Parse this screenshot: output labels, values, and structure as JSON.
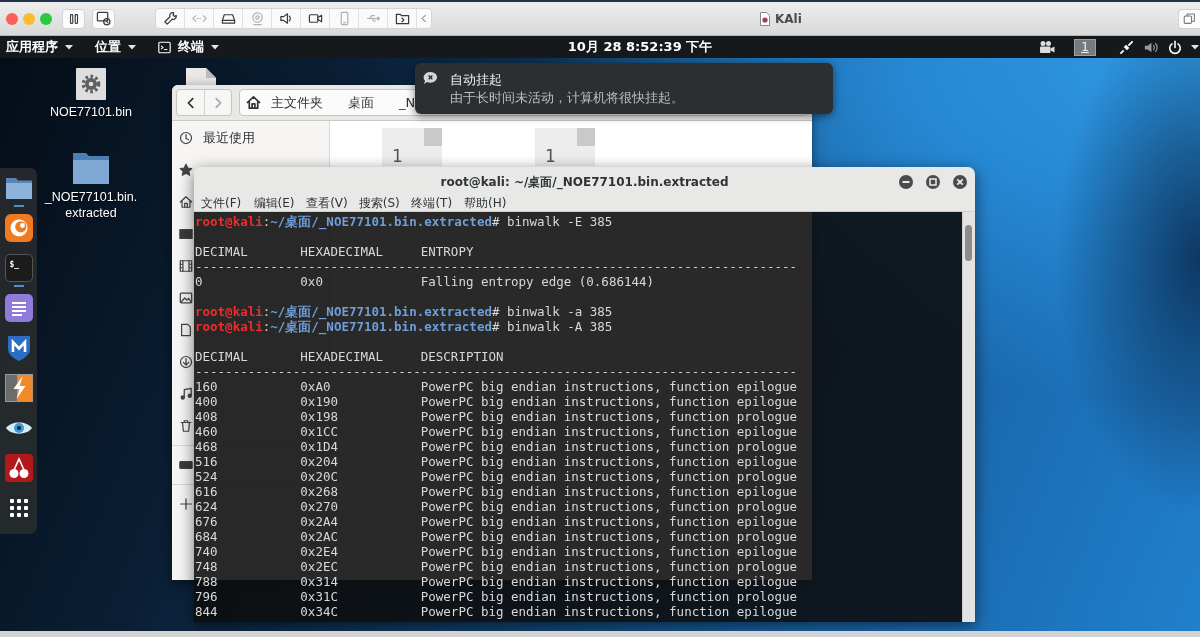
{
  "vm_window": {
    "title": "KAli",
    "toolbar": [
      {
        "kind": "wrench",
        "disabled": false
      },
      {
        "kind": "arrows",
        "disabled": true
      },
      {
        "kind": "drive",
        "disabled": false
      },
      {
        "kind": "webcam",
        "disabled": true
      },
      {
        "kind": "speaker",
        "disabled": false
      },
      {
        "kind": "camera",
        "disabled": false
      },
      {
        "kind": "phone",
        "disabled": true
      },
      {
        "kind": "usb",
        "disabled": true
      },
      {
        "kind": "folder",
        "disabled": false
      },
      {
        "kind": "chevron",
        "disabled": false
      }
    ]
  },
  "panel": {
    "menus": [
      {
        "kind": "menu",
        "label": "应用程序"
      },
      {
        "kind": "menu",
        "label": "位置"
      },
      {
        "kind": "app",
        "label": "终端"
      }
    ],
    "clock": "10月 28 8:52:39 下午",
    "workspace": "1"
  },
  "desktop": {
    "icons": [
      {
        "kind": "file",
        "label": "NOE77101.bin"
      },
      {
        "kind": "folder",
        "label": "_NOE77101.bin.extracted"
      },
      {
        "kind": "page"
      }
    ]
  },
  "dock": {
    "items": [
      {
        "kind": "files",
        "running": true
      },
      {
        "kind": "browser",
        "running": false
      },
      {
        "kind": "terminal",
        "glyph": "$_",
        "running": true
      },
      {
        "kind": "editor",
        "running": false
      },
      {
        "kind": "shield",
        "running": false
      },
      {
        "kind": "bolt",
        "running": false
      },
      {
        "kind": "eye",
        "running": false
      },
      {
        "kind": "cherries",
        "running": false
      },
      {
        "kind": "grid",
        "running": false
      }
    ]
  },
  "file_manager": {
    "nav": [
      {
        "kind": "back",
        "disabled": false
      },
      {
        "kind": "forward",
        "disabled": true
      }
    ],
    "path": [
      {
        "kind": "home",
        "label": "主文件夹"
      },
      {
        "kind": "folder",
        "label": "桌面"
      },
      {
        "kind": "folder",
        "label": "_N"
      }
    ],
    "sidebar": {
      "items": [
        {
          "kind": "recent",
          "label": "最近使用"
        },
        {
          "kind": "starred"
        },
        {
          "kind": "home"
        },
        {
          "kind": "desktop"
        },
        {
          "kind": "videos"
        },
        {
          "kind": "pictures"
        },
        {
          "kind": "documents"
        },
        {
          "kind": "downloads"
        },
        {
          "kind": "music"
        },
        {
          "kind": "trash"
        },
        {
          "kind": "separator"
        },
        {
          "kind": "drive"
        },
        {
          "kind": "separator"
        },
        {
          "kind": "other"
        }
      ]
    },
    "files": [
      {
        "preview": "1"
      },
      {
        "preview": "1"
      }
    ]
  },
  "notification": {
    "title": "自动挂起",
    "body": "由于长时间未活动，计算机将很快挂起。"
  },
  "terminal": {
    "title": "root@kali: ~/桌面/_NOE77101.bin.extracted",
    "menu": [
      "文件(F)",
      "编辑(E)",
      "查看(V)",
      "搜索(S)",
      "终端(T)",
      "帮助(H)"
    ],
    "lines": [
      {
        "kind": "prompt",
        "user": "root@kali",
        "separator": ":",
        "path": "~/桌面/_NOE77101.bin.extracted",
        "symbol": "#",
        "command": "binwalk -E 385"
      },
      {
        "kind": "blank"
      },
      {
        "kind": "header",
        "cells": [
          "DECIMAL",
          "HEXADECIMAL",
          "ENTROPY"
        ]
      },
      {
        "kind": "rule",
        "text": "--------------------------------------------------------------------------------"
      },
      {
        "kind": "row",
        "cells": [
          "0",
          "0x0",
          "Falling entropy edge (0.686144)"
        ]
      },
      {
        "kind": "blank"
      },
      {
        "kind": "prompt",
        "user": "root@kali",
        "separator": ":",
        "path": "~/桌面/_NOE77101.bin.extracted",
        "symbol": "#",
        "command": "binwalk -a 385"
      },
      {
        "kind": "prompt",
        "user": "root@kali",
        "separator": ":",
        "path": "~/桌面/_NOE77101.bin.extracted",
        "symbol": "#",
        "command": "binwalk -A 385"
      },
      {
        "kind": "blank"
      },
      {
        "kind": "header",
        "cells": [
          "DECIMAL",
          "HEXADECIMAL",
          "DESCRIPTION"
        ]
      },
      {
        "kind": "rule",
        "text": "--------------------------------------------------------------------------------"
      },
      {
        "kind": "row",
        "cells": [
          "160",
          "0xA0",
          "PowerPC big endian instructions, function epilogue"
        ]
      },
      {
        "kind": "row",
        "cells": [
          "400",
          "0x190",
          "PowerPC big endian instructions, function epilogue"
        ]
      },
      {
        "kind": "row",
        "cells": [
          "408",
          "0x198",
          "PowerPC big endian instructions, function prologue"
        ]
      },
      {
        "kind": "row",
        "cells": [
          "460",
          "0x1CC",
          "PowerPC big endian instructions, function epilogue"
        ]
      },
      {
        "kind": "row",
        "cells": [
          "468",
          "0x1D4",
          "PowerPC big endian instructions, function prologue"
        ]
      },
      {
        "kind": "row",
        "cells": [
          "516",
          "0x204",
          "PowerPC big endian instructions, function epilogue"
        ]
      },
      {
        "kind": "row",
        "cells": [
          "524",
          "0x20C",
          "PowerPC big endian instructions, function prologue"
        ]
      },
      {
        "kind": "row",
        "cells": [
          "616",
          "0x268",
          "PowerPC big endian instructions, function epilogue"
        ]
      },
      {
        "kind": "row",
        "cells": [
          "624",
          "0x270",
          "PowerPC big endian instructions, function prologue"
        ]
      },
      {
        "kind": "row",
        "cells": [
          "676",
          "0x2A4",
          "PowerPC big endian instructions, function epilogue"
        ]
      },
      {
        "kind": "row",
        "cells": [
          "684",
          "0x2AC",
          "PowerPC big endian instructions, function prologue"
        ]
      },
      {
        "kind": "row",
        "cells": [
          "740",
          "0x2E4",
          "PowerPC big endian instructions, function epilogue"
        ]
      },
      {
        "kind": "row",
        "cells": [
          "748",
          "0x2EC",
          "PowerPC big endian instructions, function prologue"
        ]
      },
      {
        "kind": "row",
        "cells": [
          "788",
          "0x314",
          "PowerPC big endian instructions, function epilogue"
        ]
      },
      {
        "kind": "row",
        "cells": [
          "796",
          "0x31C",
          "PowerPC big endian instructions, function prologue"
        ]
      },
      {
        "kind": "row",
        "cells": [
          "844",
          "0x34C",
          "PowerPC big endian instructions, function epilogue"
        ]
      }
    ]
  }
}
